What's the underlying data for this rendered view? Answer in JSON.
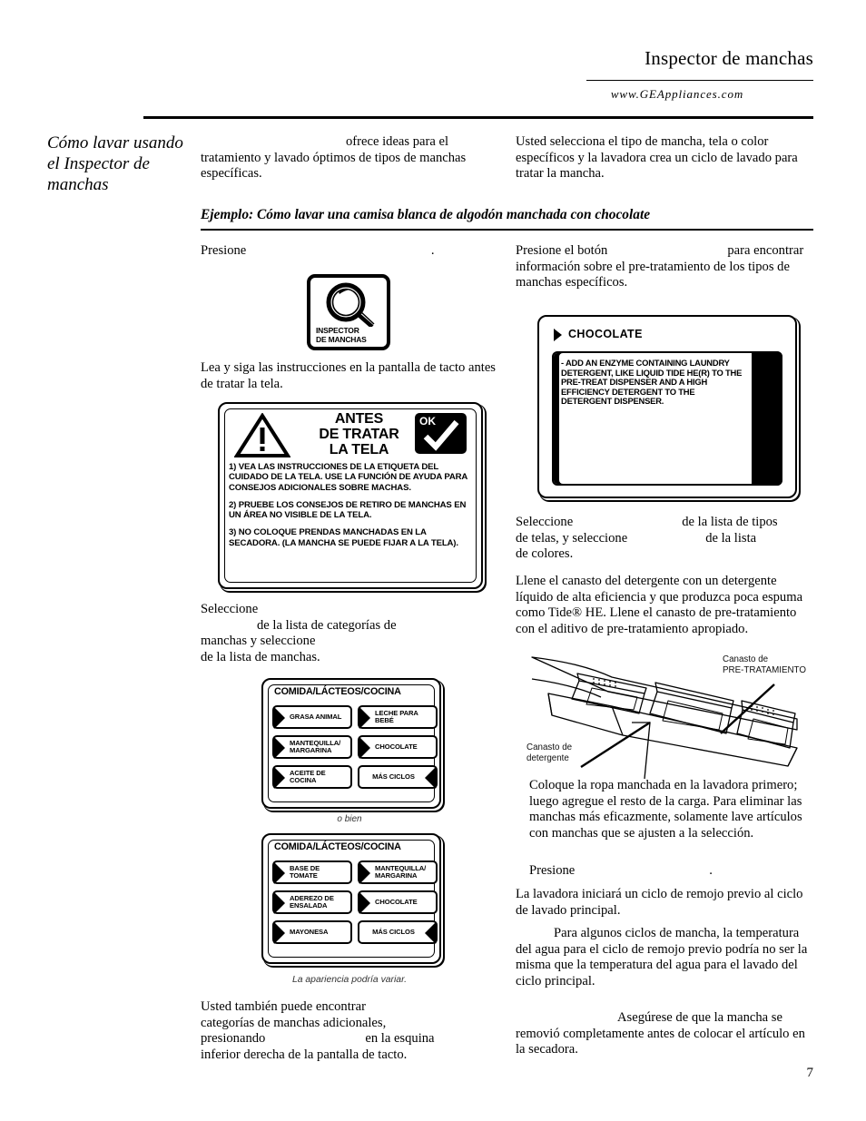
{
  "header": {
    "title": "Inspector de manchas",
    "url": "www.GEAppliances.com"
  },
  "sidebar": {
    "title": "Cómo lavar usando el Inspector de manchas"
  },
  "intro": {
    "left": "ofrece ideas para el tratamiento y lavado óptimos de tipos de manchas específicas.",
    "left_part1": "ofrece ideas para el",
    "left_part2": "tratamiento y lavado óptimos de tipos de manchas específicas.",
    "right": "Usted selecciona el tipo de mancha, tela o color específicos y la lavadora crea un ciclo de lavado para tratar la mancha."
  },
  "example": {
    "title": "Ejemplo: Cómo lavar una camisa blanca de algodón manchada con chocolate"
  },
  "left_column": {
    "step1_pre": "Presione",
    "step1_post": ".",
    "magnifier_button": {
      "line1": "INSPECTOR",
      "line2": "DE MANCHAS"
    },
    "step2": "Lea y siga las instrucciones en la pantalla de tacto antes de tratar la tela.",
    "warning": {
      "title_line1": "ANTES",
      "title_line2": "DE TRATAR",
      "title_line3": "LA TELA",
      "ok_label": "OK",
      "item1": "1) VEA LAS INSTRUCCIONES DE LA ETIQUETA DEL CUIDADO DE LA TELA. USE LA FUNCIÓN DE AYUDA PARA CONSEJOS ADICIONALES SOBRE MACHAS.",
      "item2": "2) PRUEBE LOS CONSEJOS DE RETIRO DE MANCHAS EN UN ÁREA NO VISIBLE DE LA TELA.",
      "item3": "3) NO COLOQUE PRENDAS MANCHADAS EN LA SECADORA. (LA MANCHA SE PUEDE FIJAR A LA TELA)."
    },
    "step3_a": "Seleccione",
    "step3_b": "de la lista de categorías de",
    "step3_c": "manchas y seleccione",
    "step3_d": "de la lista de manchas.",
    "menu1": {
      "header": "COMIDA/LÁCTEOS/COCINA",
      "buttons": [
        {
          "label": "GRASA ANIMAL",
          "arrow": "left"
        },
        {
          "label": "LECHE PARA BEBÉ",
          "arrow": "left"
        },
        {
          "label": "MANTEQUILLA/ MARGARINA",
          "arrow": "left"
        },
        {
          "label": "CHOCOLATE",
          "arrow": "left"
        },
        {
          "label": "ACEITE DE COCINA",
          "arrow": "left"
        },
        {
          "label": "MÁS CICLOS",
          "arrow": "right"
        }
      ]
    },
    "caption_obien": "o bien",
    "menu2": {
      "header": "COMIDA/LÁCTEOS/COCINA",
      "buttons": [
        {
          "label": "BASE DE TOMATE",
          "arrow": "left"
        },
        {
          "label": "MANTEQUILLA/ MARGARINA",
          "arrow": "left"
        },
        {
          "label": "ADEREZO DE ENSALADA",
          "arrow": "left"
        },
        {
          "label": "CHOCOLATE",
          "arrow": "left"
        },
        {
          "label": "MAYONESA",
          "arrow": "left"
        },
        {
          "label": "MÁS CICLOS",
          "arrow": "right"
        }
      ]
    },
    "caption_variar": "La apariencia podría variar.",
    "step4_a": "Usted también puede encontrar",
    "step4_b": "categorías de manchas adicionales,",
    "step4_c": "presionando",
    "step4_d": "en la esquina",
    "step4_e": "inferior derecha de la pantalla de tacto."
  },
  "right_column": {
    "step1_a": "Presione el botón",
    "step1_b": "para",
    "step1_c": "encontrar información sobre el pre-tratamiento de los tipos de manchas específicos.",
    "chocolate_screen": {
      "header": "CHOCOLATE",
      "body": "- ADD AN ENZYME CONTAINING LAUNDRY DETERGENT, LIKE LIQUID TIDE HE(R) TO THE PRE-TREAT DISPENSER AND A HIGH EFFICIENCY DETERGENT TO THE DETERGENT DISPENSER."
    },
    "step2_a": "Seleccione",
    "step2_b": "de la lista de tipos",
    "step2_c": "de telas, y seleccione",
    "step2_d": "de la lista",
    "step2_e": "de colores.",
    "step3": "Llene el canasto del detergente con un detergente líquido de alta eficiencia y que produzca poca espuma como Tide® HE. Llene el canasto de pre-tratamiento con el aditivo de pre-tratamiento apropiado.",
    "dispenser": {
      "label_pretreat_line1": "Canasto de",
      "label_pretreat_line2": "PRE-TRATAMIENTO",
      "label_detergent_line1": "Canasto de",
      "label_detergent_line2": "detergente"
    },
    "step4": "Coloque la ropa manchada en la lavadora primero; luego agregue el resto de la carga. Para eliminar las manchas más eficazmente, solamente lave artículos con manchas que se ajusten a la selección.",
    "step5_pre": "Presione",
    "step5_post": ".",
    "step6": "La lavadora iniciará un ciclo de remojo previo al ciclo de lavado principal.",
    "note1_a": "Para algunos ciclos de mancha,",
    "note1_b": "la temperatura del agua para el ciclo de remojo previo podría no ser la misma que la temperatura del agua para el lavado del ciclo principal.",
    "note2_a": "Asegúrese de que la mancha",
    "note2_b": "se removió completamente antes de colocar el artículo en la secadora."
  },
  "page_number": "7"
}
